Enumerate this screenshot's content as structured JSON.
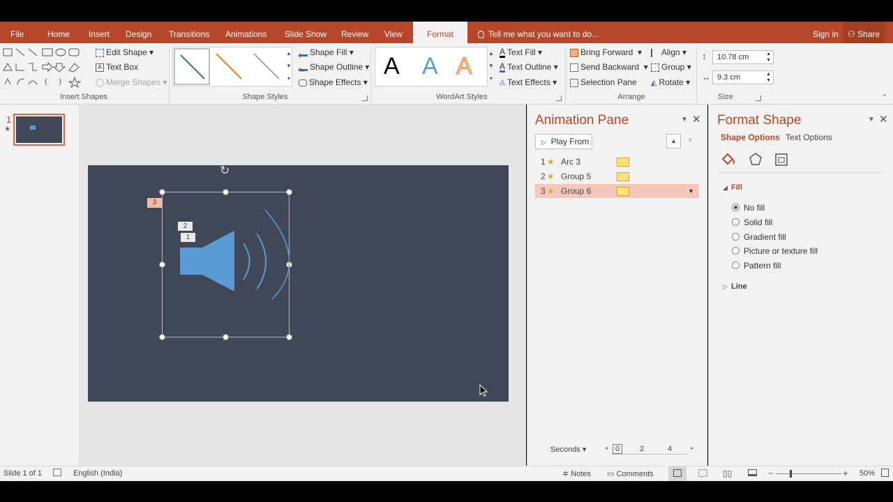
{
  "app": {
    "accent": "#b7472a",
    "slide_bg": "#404756"
  },
  "tabs": [
    {
      "label": "File"
    },
    {
      "label": "Home"
    },
    {
      "label": "Insert"
    },
    {
      "label": "Design"
    },
    {
      "label": "Transitions"
    },
    {
      "label": "Animations"
    },
    {
      "label": "Slide Show"
    },
    {
      "label": "Review"
    },
    {
      "label": "View"
    },
    {
      "label": "Format"
    }
  ],
  "tell_me": "Tell me what you want to do...",
  "sign_in": "Sign in",
  "share": "Share",
  "ribbon": {
    "insert_shapes": {
      "label": "Insert Shapes",
      "edit_shape": "Edit Shape",
      "text_box": "Text Box",
      "merge_shapes": "Merge Shapes"
    },
    "shape_styles": {
      "label": "Shape Styles",
      "fill": "Shape Fill",
      "outline": "Shape Outline",
      "effects": "Shape Effects"
    },
    "wordart": {
      "label": "WordArt Styles",
      "text_fill": "Text Fill",
      "text_outline": "Text Outline",
      "text_effects": "Text Effects",
      "letters": [
        "A",
        "A",
        "A"
      ]
    },
    "arrange": {
      "label": "Arrange",
      "bring_forward": "Bring Forward",
      "send_backward": "Send Backward",
      "selection_pane": "Selection Pane",
      "align": "Align",
      "group": "Group",
      "rotate": "Rotate"
    },
    "size": {
      "label": "Size",
      "height": "10.78 cm",
      "width": "9.3 cm"
    }
  },
  "thumbnail": {
    "number": "1",
    "star": "★"
  },
  "slide": {
    "tag3": "3",
    "tag2": "2",
    "tag1": "1"
  },
  "animation_pane": {
    "title": "Animation Pane",
    "play_from": "Play From",
    "items": [
      {
        "num": "1",
        "name": "Arc 3"
      },
      {
        "num": "2",
        "name": "Group 5"
      },
      {
        "num": "3",
        "name": "Group 6"
      }
    ],
    "seconds": "Seconds",
    "timeline": [
      "0",
      "2",
      "4"
    ]
  },
  "format_pane": {
    "title": "Format Shape",
    "tab_shape": "Shape Options",
    "tab_text": "Text Options",
    "fill_header": "Fill",
    "options": [
      "No fill",
      "Solid fill",
      "Gradient fill",
      "Picture or texture fill",
      "Pattern fill"
    ],
    "selected_index": 0,
    "line_header": "Line"
  },
  "status": {
    "slide": "Slide 1 of 1",
    "language": "English (India)",
    "notes": "Notes",
    "comments": "Comments",
    "zoom": "50%"
  }
}
